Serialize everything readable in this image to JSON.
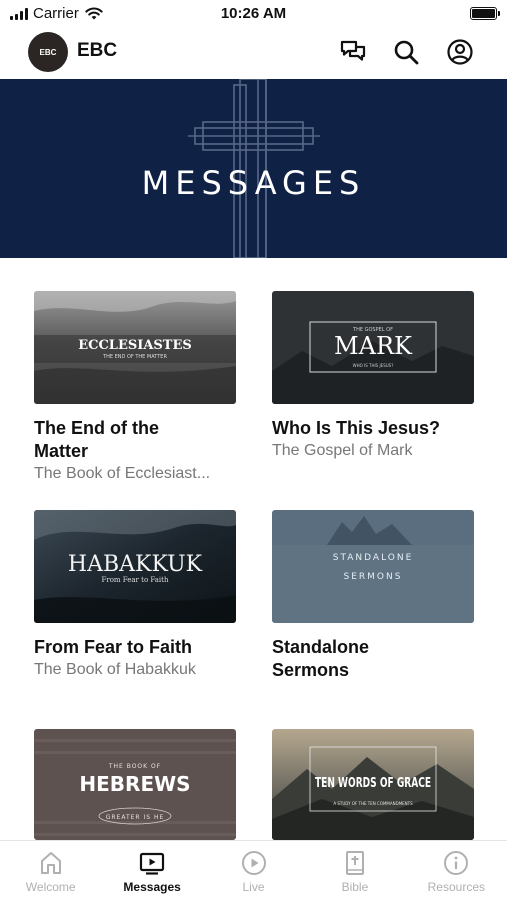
{
  "status_bar": {
    "carrier": "Carrier",
    "time": "10:26 AM"
  },
  "header": {
    "avatar_text": "EBC",
    "title": "EBC",
    "icons": [
      "chat-icon",
      "search-icon",
      "profile-icon"
    ]
  },
  "hero": {
    "title": "MESSAGES"
  },
  "series": [
    {
      "thumb_title": "ECCLESIASTES",
      "thumb_subtitle": "THE END OF THE MATTER",
      "title": "The End of the Matter",
      "subtitle": "The Book of Ecclesiast..."
    },
    {
      "thumb_top": "THE GOSPEL OF",
      "thumb_title": "MARK",
      "thumb_subtitle": "WHO IS THIS JESUS?",
      "title": "Who Is This Jesus?",
      "subtitle": "The Gospel of Mark"
    },
    {
      "thumb_title": "HABAKKUK",
      "thumb_subtitle": "From Fear to Faith",
      "title": "From Fear to Faith",
      "subtitle": "The Book of Habakkuk"
    },
    {
      "thumb_title": "STANDALONE",
      "thumb_subtitle": "SERMONS",
      "title": "Standalone Sermons",
      "subtitle": ""
    },
    {
      "thumb_top": "THE BOOK OF",
      "thumb_title": "HEBREWS",
      "thumb_subtitle": "GREATER IS HE",
      "title": "",
      "subtitle": ""
    },
    {
      "thumb_title": "TEN WORDS OF GRACE",
      "thumb_subtitle": "A STUDY OF THE TEN COMMANDMENTS",
      "title": "",
      "subtitle": ""
    }
  ],
  "tabs": [
    {
      "label": "Welcome",
      "icon": "home-icon",
      "active": false
    },
    {
      "label": "Messages",
      "icon": "tv-play-icon",
      "active": true
    },
    {
      "label": "Live",
      "icon": "play-circle-icon",
      "active": false
    },
    {
      "label": "Bible",
      "icon": "bible-icon",
      "active": false
    },
    {
      "label": "Resources",
      "icon": "info-icon",
      "active": false
    }
  ],
  "colors": {
    "hero_background": "#0f2245",
    "active_tab": "#111111",
    "inactive_tab": "#b0b0b0"
  }
}
